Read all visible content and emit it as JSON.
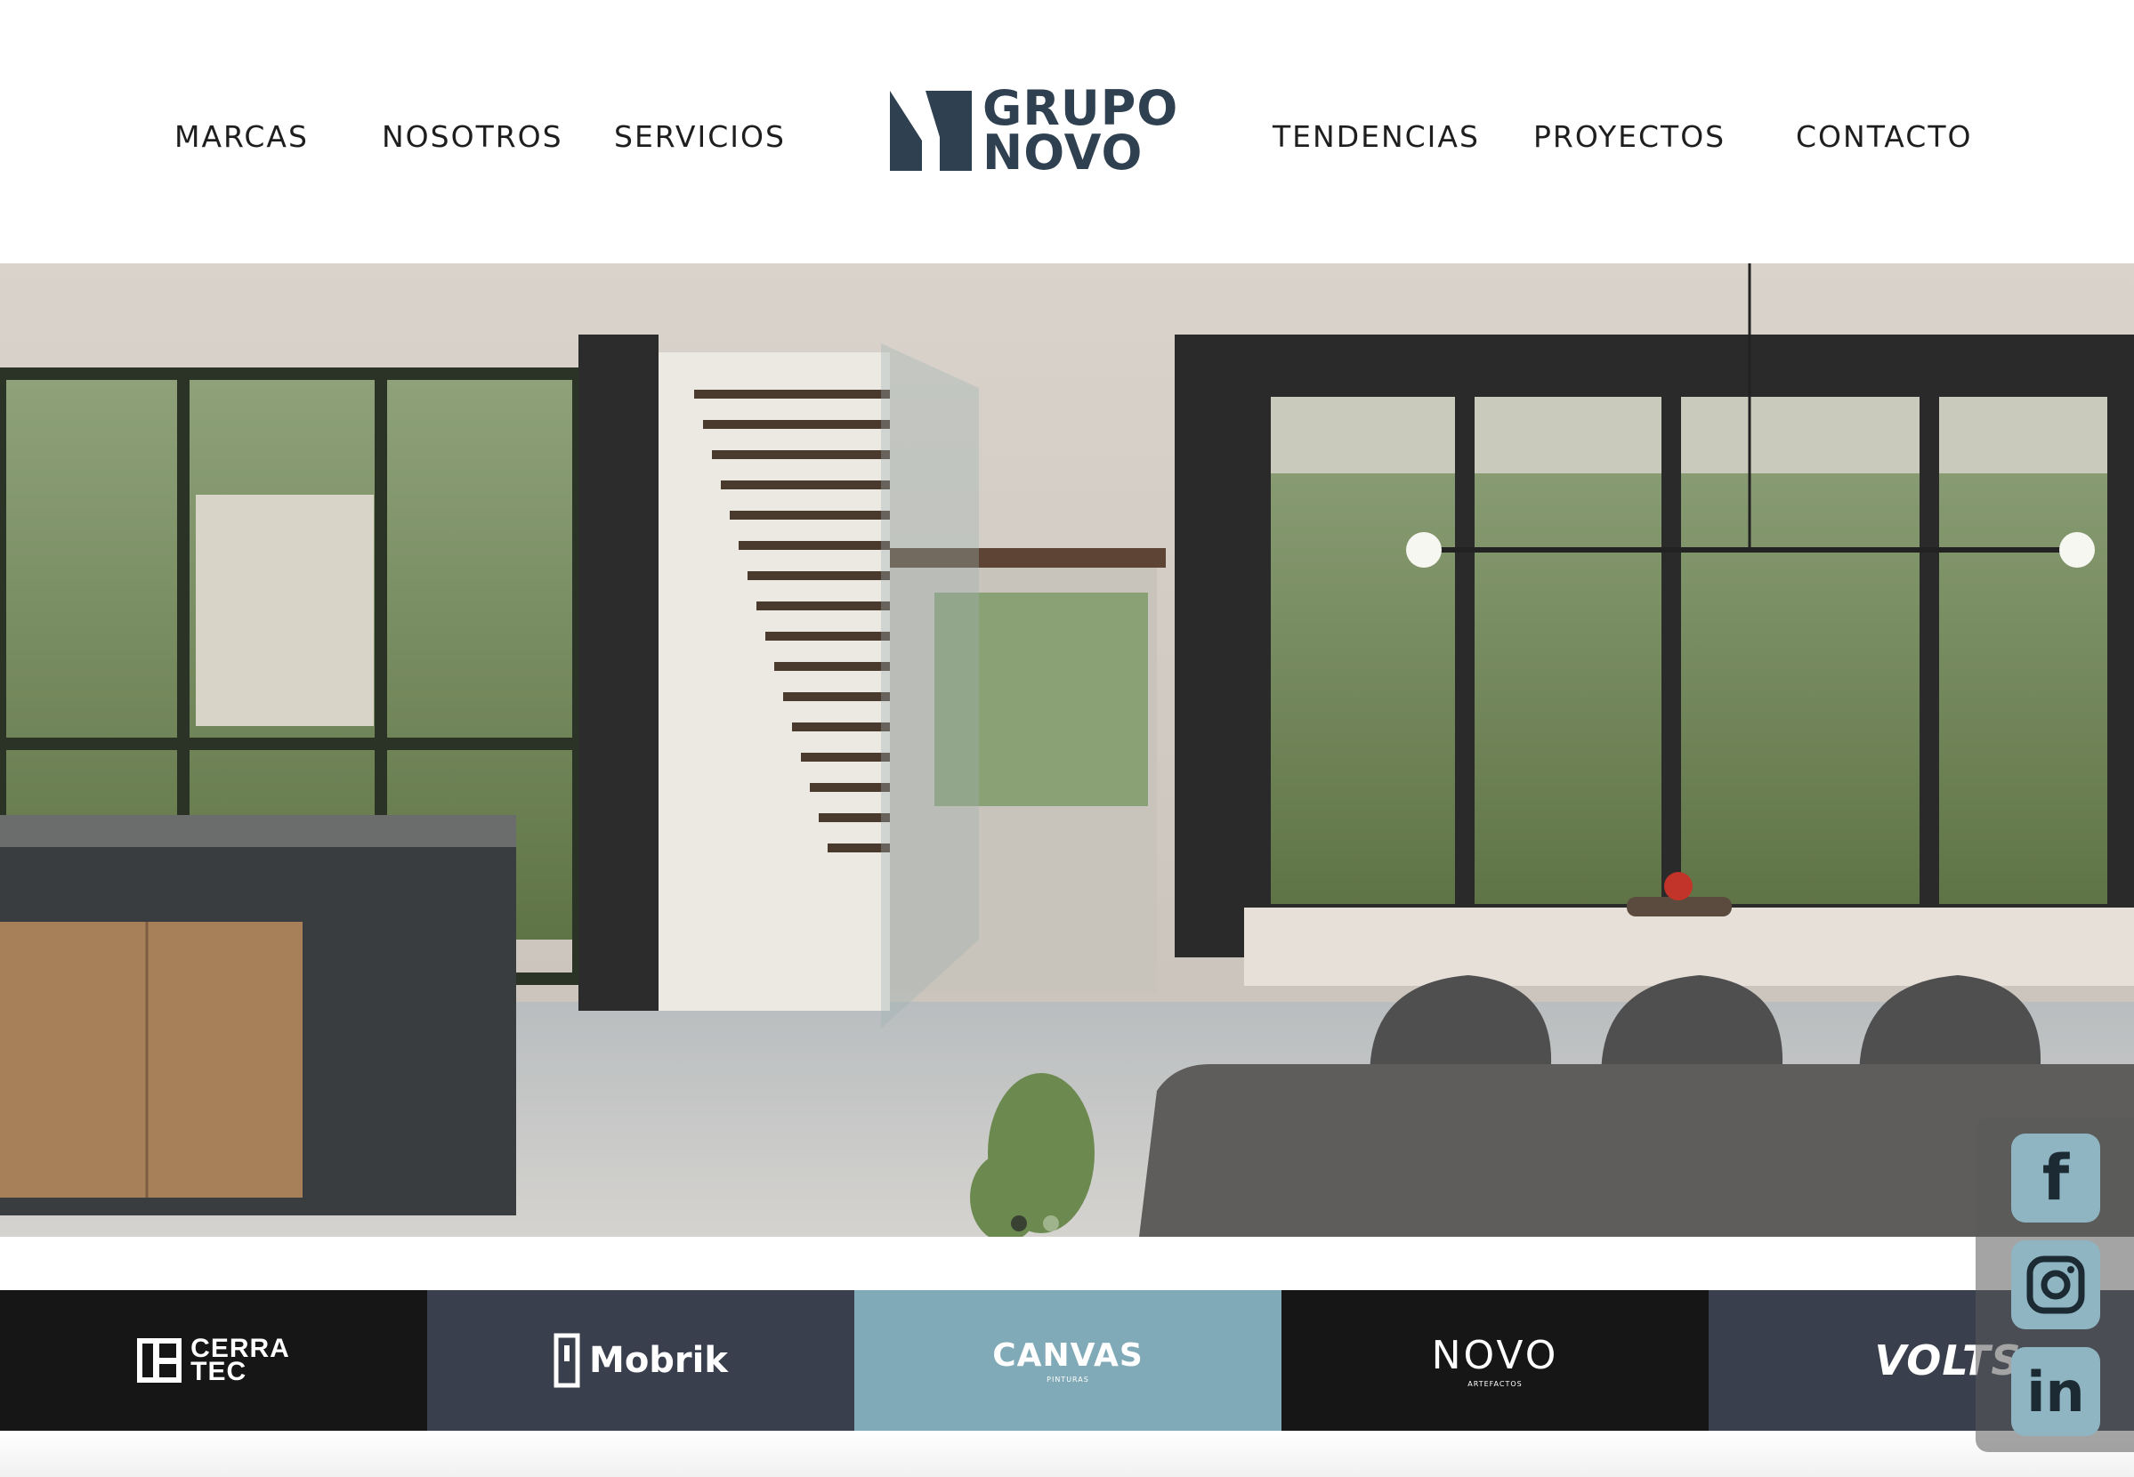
{
  "nav": {
    "left": [
      {
        "label": "MARCAS"
      },
      {
        "label": "NOSOTROS"
      },
      {
        "label": "SERVICIOS"
      }
    ],
    "right": [
      {
        "label": "TENDENCIAS"
      },
      {
        "label": "PROYECTOS"
      },
      {
        "label": "CONTACTO"
      }
    ]
  },
  "logo": {
    "line1": "GRUPO",
    "line2": "NOVO",
    "color": "#2f4050"
  },
  "hero": {
    "slide_count": 2,
    "active_slide": 1
  },
  "brands": [
    {
      "name_line1": "CERRA",
      "name_line2": "TEC",
      "bg": "#161616"
    },
    {
      "name": "Mobrik",
      "bg": "#393f4c"
    },
    {
      "name": "CANVAS",
      "sub": "PINTURAS",
      "bg": "#80aab7"
    },
    {
      "name": "NOVO",
      "sub": "ARTEFACTOS",
      "bg": "#161616"
    },
    {
      "name": "VOLTS",
      "bg": "#393f4c"
    }
  ],
  "social": [
    {
      "icon": "facebook-icon",
      "glyph": "f"
    },
    {
      "icon": "instagram-icon"
    },
    {
      "icon": "linkedin-icon",
      "glyph": "in"
    }
  ]
}
